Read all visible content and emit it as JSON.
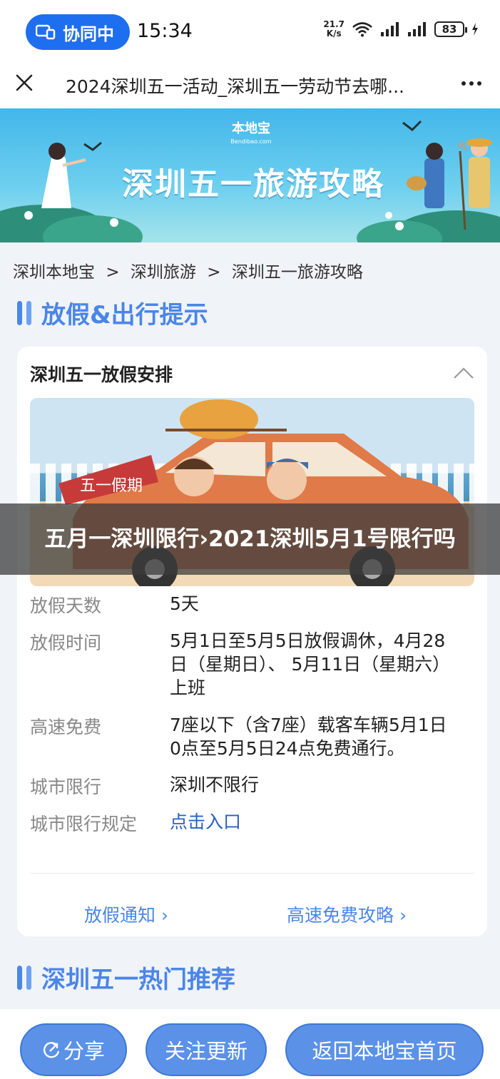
{
  "status_bar": {
    "collab_label": "协同中",
    "time": "15:34",
    "net_speed_value": "21.7",
    "net_speed_unit": "K/s",
    "battery": "83"
  },
  "title_bar": {
    "title": "2024深圳五一活动_深圳五一劳动节去哪..."
  },
  "banner": {
    "logo": "本地宝",
    "logo_sub": "Bendibao.com",
    "title": "深圳五一旅游攻略"
  },
  "breadcrumb": [
    "深圳本地宝",
    ">",
    "深圳旅游",
    ">",
    "深圳五一旅游攻略"
  ],
  "section1": {
    "title": "放假&出行提示"
  },
  "card": {
    "title": "深圳五一放假安排",
    "illustration_sign": "五一假期",
    "rows": [
      {
        "label": "放假天数",
        "value": "5天"
      },
      {
        "label": "放假时间",
        "value": "5月1日至5月5日放假调休，4月28日（星期日）、 5月11日（星期六）上班"
      },
      {
        "label": "高速免费",
        "value": "7座以下（含7座）载客车辆5月1日0点至5月5日24点免费通行。"
      },
      {
        "label": "城市限行",
        "value": "深圳不限行"
      },
      {
        "label": "城市限行规定",
        "value": "点击入口"
      }
    ],
    "link_left": "放假通知 ›",
    "link_right": "高速免费攻略 ›"
  },
  "section2": {
    "title": "深圳五一热门推荐"
  },
  "overlay": {
    "caption": "五月一深圳限行›2021深圳5月1号限行吗"
  },
  "bottom_bar": {
    "share": "分享",
    "follow": "关注更新",
    "home": "返回本地宝首页"
  },
  "colors": {
    "accent": "#4a86e8",
    "collab": "#1e6ef0",
    "link": "#2a5fc7",
    "pill": "#5b92e8"
  }
}
